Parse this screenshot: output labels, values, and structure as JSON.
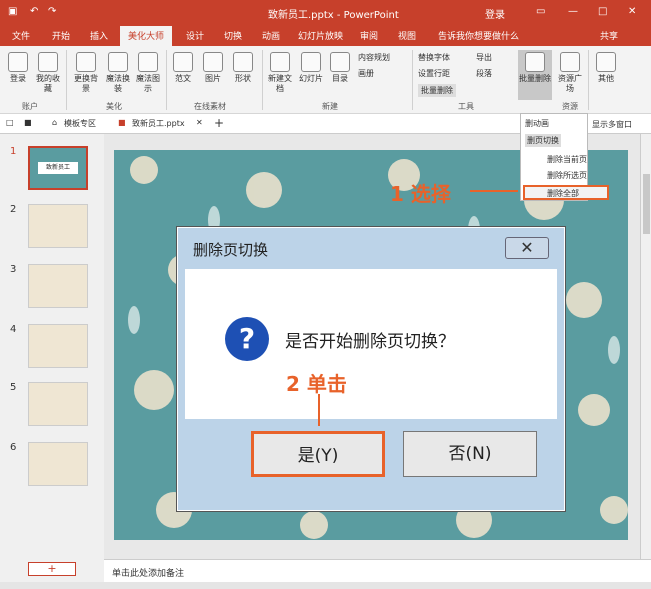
{
  "title": {
    "filename": "致新员工.pptx - PowerPoint",
    "login": "登录",
    "save_icon": "save-icon"
  },
  "tabs": [
    "文件",
    "开始",
    "插入",
    "美化大师",
    "设计",
    "切换",
    "动画",
    "幻灯片放映",
    "审阅",
    "视图",
    "告诉我你想要做什么",
    "共享"
  ],
  "ribbon": {
    "account": {
      "items": [
        "登录",
        "我的收藏"
      ],
      "group": "账户"
    },
    "beautify": {
      "items": [
        "更换背景",
        "魔法换装",
        "魔法图示"
      ],
      "group": "美化"
    },
    "materials": {
      "items": [
        "范文",
        "图片",
        "形状"
      ],
      "group": "在线素材"
    },
    "create": {
      "items": [
        "新建文档",
        "幻灯片",
        "目录"
      ],
      "small": [
        "内容规划",
        "画册"
      ],
      "group": "新建"
    },
    "tools": {
      "small": [
        "替换字体",
        "设置行距",
        "批量删除",
        "导出",
        "段落"
      ],
      "group": "工具"
    },
    "batch_delete": "批量删除",
    "resource": "资源广场",
    "resource_group": "资源",
    "other": "其他"
  },
  "doctabs": [
    "模板专区",
    "致新员工.pptx",
    "+",
    "显示多窗口"
  ],
  "dropdown": {
    "items": [
      "删动画",
      "删页切换",
      "删除当前页",
      "删除所选页",
      "删除全部"
    ]
  },
  "thumbs": {
    "numbers": [
      "1",
      "2",
      "3",
      "4",
      "5",
      "6"
    ],
    "title_text": "致新员工"
  },
  "notes": "单击此处添加备注",
  "add_button": "+",
  "dialog": {
    "title": "删除页切换",
    "close": "✕",
    "question_mark": "?",
    "message": "是否开始删除页切换？",
    "yes": "是(Y)",
    "no": "否(N)"
  },
  "callouts": {
    "step1": "1 选择",
    "step2": "2 单击"
  }
}
